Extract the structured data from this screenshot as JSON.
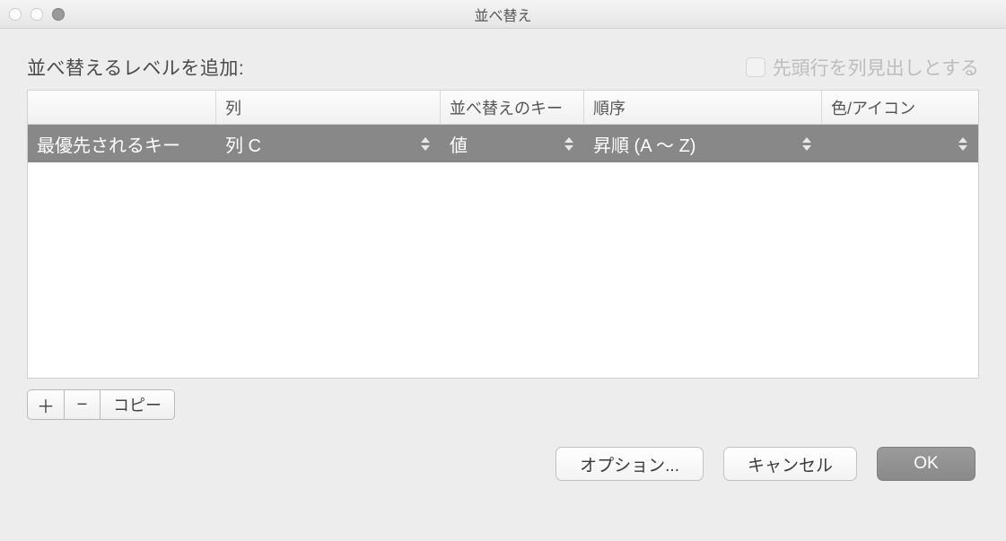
{
  "window": {
    "title": "並べ替え"
  },
  "header": {
    "add_label": "並べ替えるレベルを追加:",
    "header_row_checkbox_label": "先頭行を列見出しとする"
  },
  "table": {
    "columns": {
      "level": "",
      "column": "列",
      "sort_key": "並べ替えのキー",
      "order": "順序",
      "color_icon": "色/アイコン"
    },
    "rows": [
      {
        "level": "最優先されるキー",
        "column": "列 C",
        "sort_key": "値",
        "order": "昇順 (A 〜 Z)",
        "color_icon": ""
      }
    ]
  },
  "toolbar": {
    "add": "＋",
    "remove": "−",
    "copy": "コピー"
  },
  "footer": {
    "options": "オプション...",
    "cancel": "キャンセル",
    "ok": "OK"
  }
}
